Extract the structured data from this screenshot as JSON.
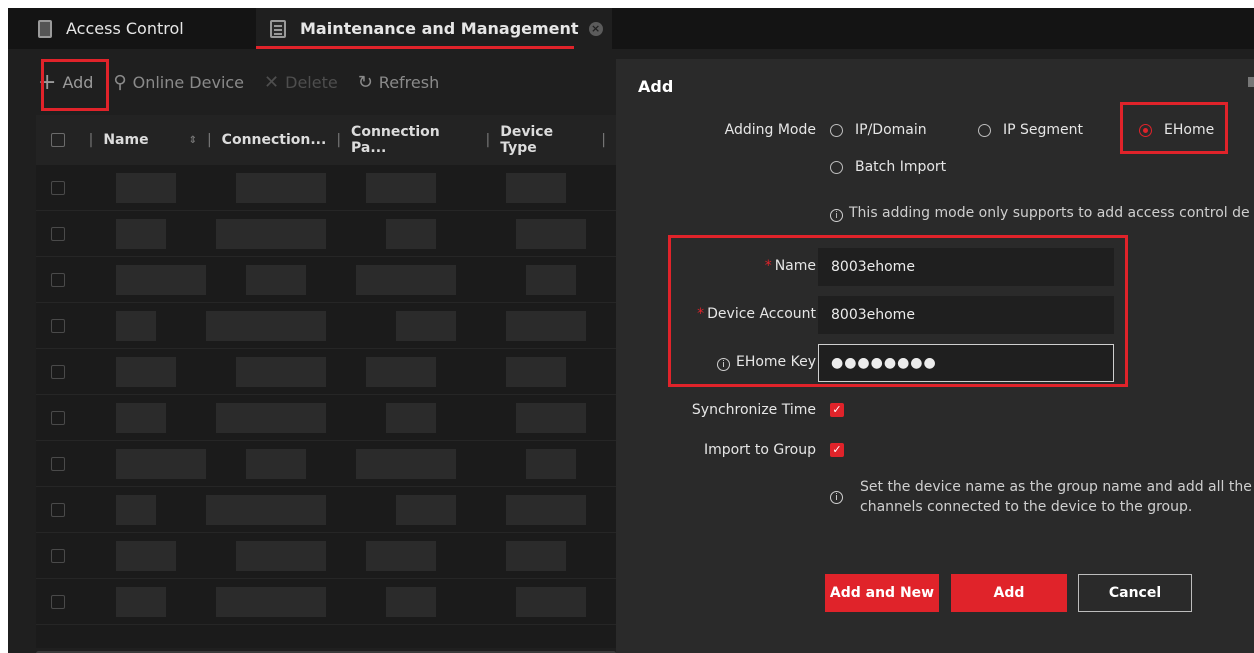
{
  "tabs": [
    {
      "label": "Access Control",
      "icon": "door-icon",
      "active": false
    },
    {
      "label": "Maintenance and Management",
      "icon": "maintenance-icon",
      "active": true
    }
  ],
  "toolbar": {
    "add_label": "Add",
    "online_device_label": "Online Device",
    "delete_label": "Delete",
    "refresh_label": "Refresh"
  },
  "table": {
    "columns": [
      "Name",
      "Connection...",
      "Connection Pa...",
      "Device Type"
    ],
    "row_count": 10
  },
  "dialog": {
    "title": "Add",
    "adding_mode_label": "Adding Mode",
    "modes": [
      {
        "label": "IP/Domain",
        "selected": false
      },
      {
        "label": "IP Segment",
        "selected": false
      },
      {
        "label": "EHome",
        "selected": true
      },
      {
        "label": "Batch Import",
        "selected": false
      }
    ],
    "mode_hint": "This adding mode only supports to add access control de",
    "name_label": "Name",
    "name_value": "8003ehome",
    "device_account_label": "Device Account",
    "device_account_value": "8003ehome",
    "ehome_key_label": "EHome Key",
    "ehome_key_value": "●●●●●●●●",
    "sync_time_label": "Synchronize Time",
    "sync_time_checked": true,
    "import_group_label": "Import to Group",
    "import_group_checked": true,
    "group_hint_line1": "Set the device name as the group name and add all the",
    "group_hint_line2": "channels connected to the device to the group.",
    "add_and_new_label": "Add and New",
    "add_label": "Add",
    "cancel_label": "Cancel"
  },
  "colors": {
    "accent": "#e0232a",
    "background": "#1f1f1f",
    "dialog_bg": "#2a2a2a"
  }
}
